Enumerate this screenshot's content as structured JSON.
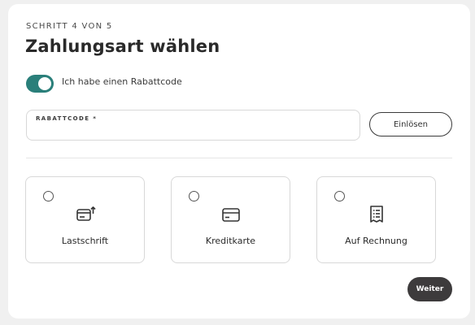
{
  "header": {
    "step": "SCHRITT 4 VON 5",
    "title": "Zahlungsart wählen"
  },
  "discount": {
    "toggle_on": true,
    "toggle_label": "Ich habe einen Rabattcode",
    "field_label": "RABATTCODE *",
    "field_value": "",
    "redeem_label": "Einlösen"
  },
  "payment_options": [
    {
      "label": "Lastschrift",
      "icon": "direct-debit-icon",
      "selected": false
    },
    {
      "label": "Kreditkarte",
      "icon": "credit-card-icon",
      "selected": false
    },
    {
      "label": "Auf Rechnung",
      "icon": "invoice-icon",
      "selected": false
    }
  ],
  "footer": {
    "next_label": "Weiter"
  },
  "colors": {
    "accent": "#2a7f7a",
    "primary_button": "#3d3b3c"
  }
}
